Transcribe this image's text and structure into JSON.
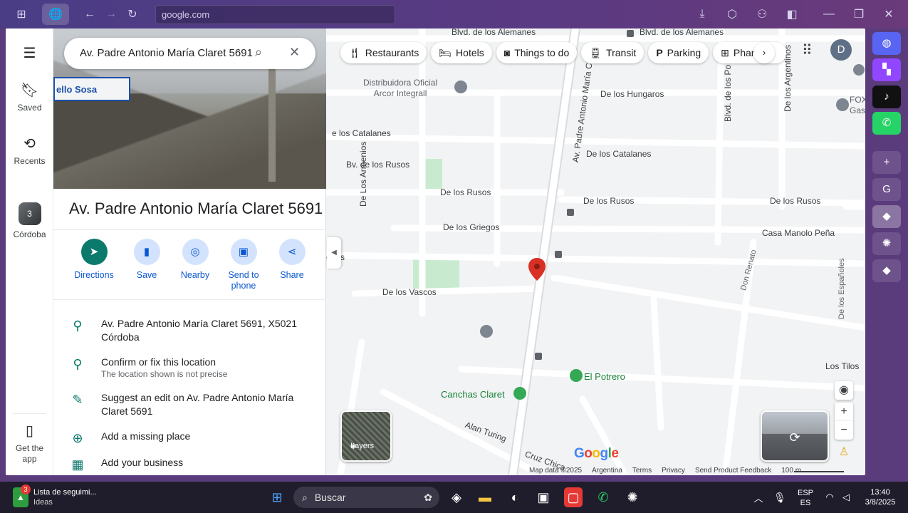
{
  "browser": {
    "url": "google.com"
  },
  "rail": {
    "menu_icon": "hamburger-icon",
    "saved": "Saved",
    "recents": "Recents",
    "place_count": "3",
    "place_name": "Córdoba",
    "get_app": "Get the\napp"
  },
  "search": {
    "query": "Av. Padre Antonio María Claret 5691"
  },
  "photo": {
    "sign_text": "ello Sosa"
  },
  "place": {
    "title": "Av. Padre Antonio María Claret 5691",
    "actions": {
      "directions": "Directions",
      "save": "Save",
      "nearby": "Nearby",
      "send_to_phone": "Send to\nphone",
      "share": "Share"
    },
    "address": "Av. Padre Antonio María Claret 5691, X5021 Córdoba",
    "confirm": "Confirm or fix this location",
    "confirm_sub": "The location shown is not precise",
    "suggest": "Suggest an edit on Av. Padre Antonio María Claret 5691",
    "add_place": "Add a missing place",
    "add_business": "Add your business"
  },
  "map": {
    "chips": {
      "restaurants": "Restaurants",
      "hotels": "Hotels",
      "things_to_do": "Things to do",
      "transit": "Transit",
      "parking": "Parking",
      "pharmacies": "Pharma"
    },
    "avatar": "D",
    "labels": {
      "alemanes_1": "Blvd. de los Alemanes",
      "alemanes_2": "Blvd. de los Alemanes",
      "distribuidora": "Distribuidora Oficial\nArcor Integrall",
      "hungaros": "De los Hungaros",
      "catalanes_1": "e los Catalanes",
      "catalanes_2": "De los Catalanes",
      "rusos_bv": "Bv. de los Rusos",
      "rusos_1": "De los Rusos",
      "rusos_2": "De los Rusos",
      "griegos": "De los Griegos",
      "armenios": "De Los Armenios",
      "claret_street": "Av. Padre Antonio María Claret",
      "blvd_po": "Blvd. de los Po",
      "argentinos": "De los Argentinos",
      "fox": "FOX\nGas",
      "casa_manolo": "Casa Manolo Peña",
      "don_renato": "Don Renato",
      "espanoles": "De los Españoles",
      "suecos": "eños",
      "vascos": "De los Vascos",
      "el_potrero": "El Potrero",
      "canchas": "Canchas Claret",
      "alan_turing": "Alan Turing",
      "cruz": "Cruz Chica",
      "los_tilos": "Los Tilos"
    },
    "layers": "Layers",
    "google": "Google",
    "footer": {
      "map_data": "Map data ©2025",
      "argentina": "Argentina",
      "terms": "Terms",
      "privacy": "Privacy",
      "feedback": "Send Product Feedback",
      "scale": "100 m"
    }
  },
  "taskbar": {
    "notification_count": "3",
    "widget_title": "Lista de seguimi...",
    "widget_sub": "Ideas",
    "search": "Buscar",
    "lang": "ESP",
    "lang_sub": "ES",
    "time": "13:40",
    "date": "3/8/2025"
  },
  "colors": {
    "accent": "#0b57d0",
    "teal": "#0b7a6c",
    "pin": "#d93025",
    "browser_bg": "#4a3d86"
  }
}
